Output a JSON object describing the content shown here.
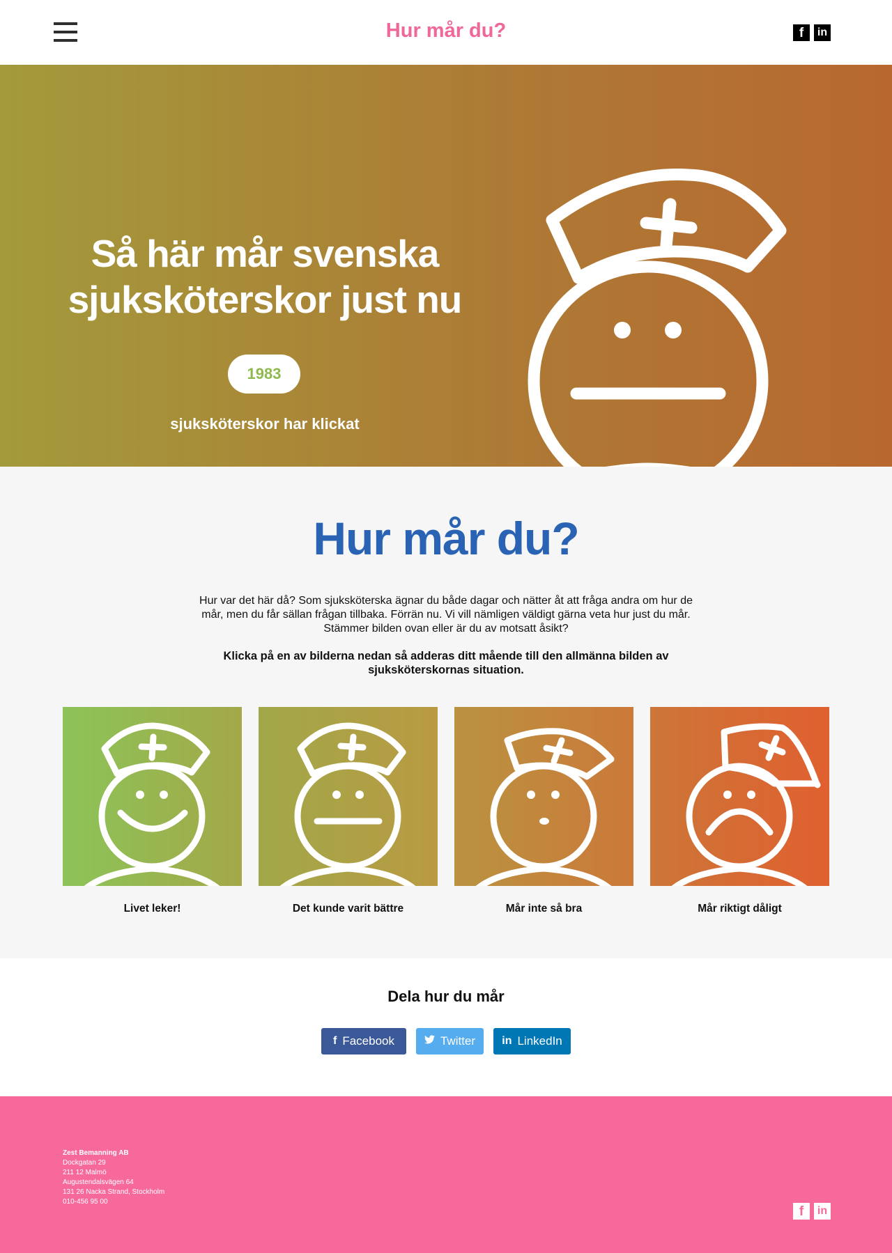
{
  "header": {
    "title": "Hur mår du?",
    "menu_icon": "hamburger-icon",
    "social": [
      {
        "name": "facebook",
        "glyph": "f"
      },
      {
        "name": "linkedin",
        "glyph": "in"
      }
    ]
  },
  "hero": {
    "title_line1": "Så här mår svenska",
    "title_line2": "sjuksköterskor just nu",
    "count": "1983",
    "caption": "sjuksköterskor har klickat",
    "illustration": "neutral-nurse-icon",
    "gradient": [
      "#a39a3b",
      "#b8682f"
    ]
  },
  "main": {
    "title": "Hur mår du?",
    "intro": "Hur var det här då? Som sjuksköterska ägnar du både dagar och nätter åt att fråga andra om hur de mår, men du får sällan frågan tillbaka. Förrän nu. Vi vill nämligen väldigt gärna veta hur just du mår. Stämmer bilden ovan eller är du av motsatt åsikt?",
    "instruction": "Klicka på en av bilderna nedan så adderas ditt mående till den allmänna bilden av sjuksköterskornas situation.",
    "options": [
      {
        "label": "Livet leker!",
        "mood": "happy",
        "colors": [
          "#8cc459",
          "#a3a848"
        ]
      },
      {
        "label": "Det kunde varit bättre",
        "mood": "neutral",
        "colors": [
          "#a1a849",
          "#b99a42"
        ]
      },
      {
        "label": "Mår inte så bra",
        "mood": "surprised",
        "colors": [
          "#b9933f",
          "#cc793a"
        ]
      },
      {
        "label": "Mår riktigt dåligt",
        "mood": "sad",
        "colors": [
          "#cc7638",
          "#e06030"
        ]
      }
    ]
  },
  "share": {
    "title": "Dela hur du mår",
    "buttons": [
      {
        "label": "Facebook",
        "icon": "f",
        "color": "#3b5998"
      },
      {
        "label": "Twitter",
        "icon": "🐦",
        "color": "#55acee"
      },
      {
        "label": "LinkedIn",
        "icon": "in",
        "color": "#0077b5"
      }
    ]
  },
  "footer": {
    "company": "Zest Bemanning AB",
    "address_lines": [
      "Dockgatan 29",
      "211 12 Malmö",
      "Augustendalsvägen 64",
      "131 26 Nacka Strand, Stockholm",
      "010-456 95 00"
    ],
    "background": "#f8699b"
  }
}
